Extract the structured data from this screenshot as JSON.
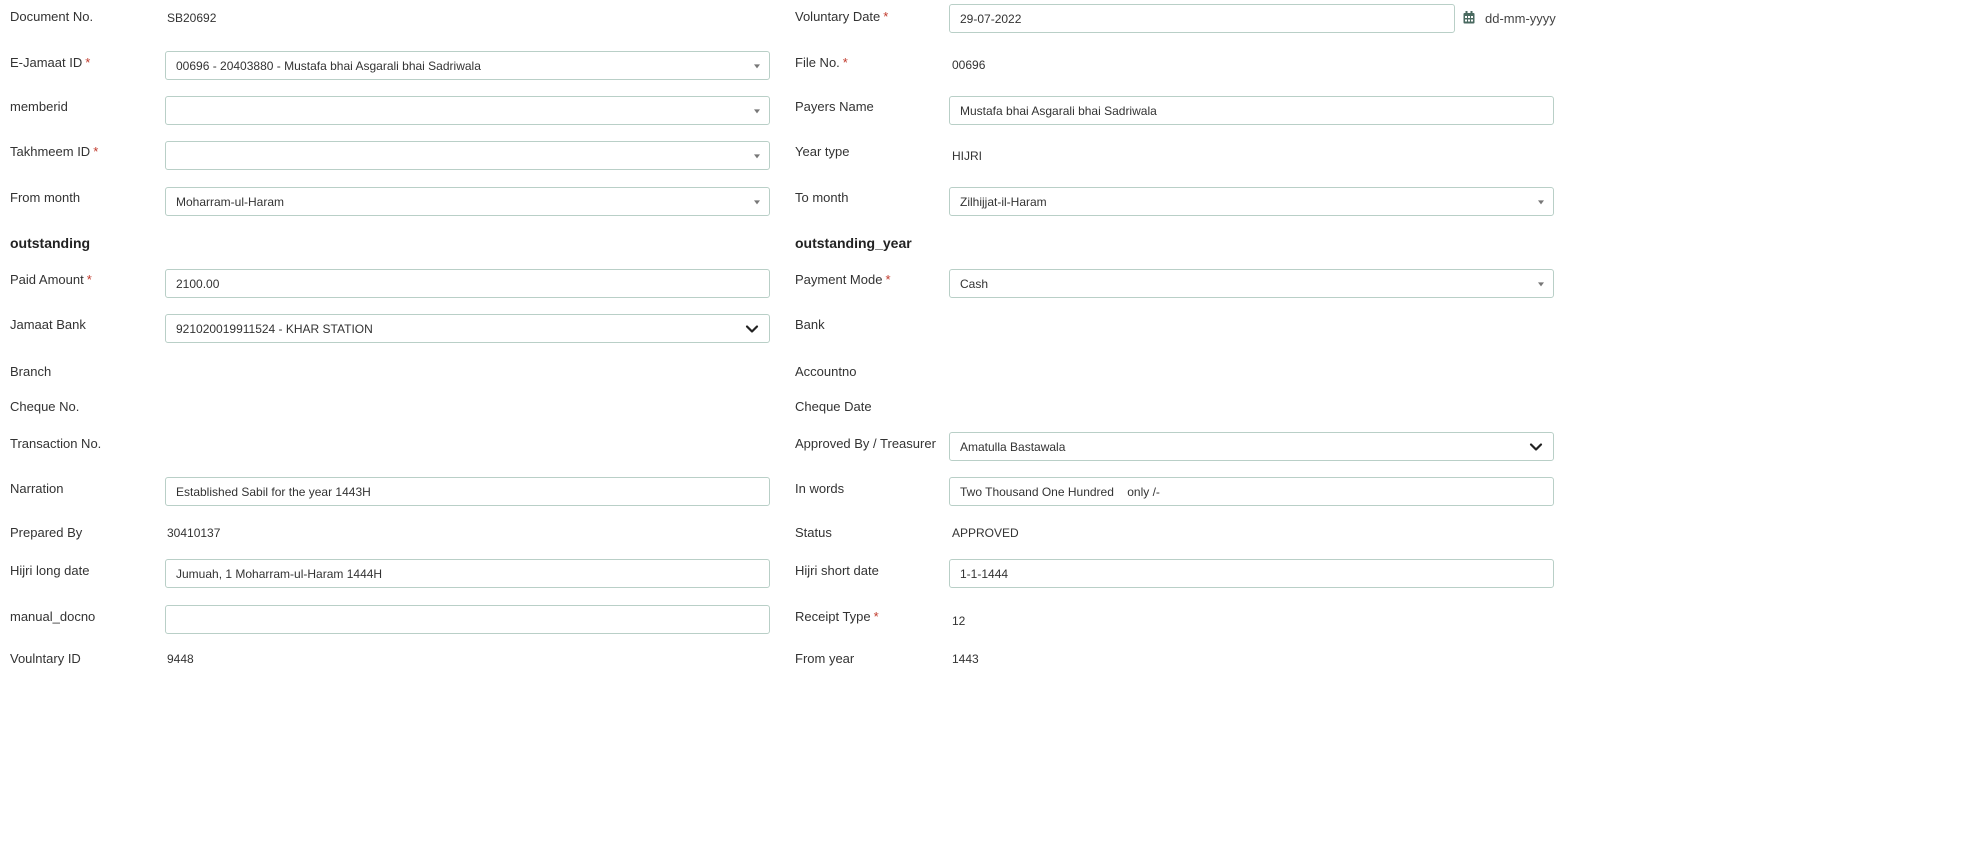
{
  "left": {
    "document_no": {
      "label": "Document No.",
      "value": "SB20692"
    },
    "ejamaat_id": {
      "label": "E-Jamaat ID",
      "required_mark": "*",
      "value": "00696 - 20403880 - Mustafa bhai Asgarali bhai Sadriwala"
    },
    "memberid": {
      "label": "memberid",
      "value": ""
    },
    "takhmeem_id": {
      "label": "Takhmeem ID",
      "required_mark": "*",
      "value": ""
    },
    "from_month": {
      "label": "From month",
      "value": "Moharram-ul-Haram"
    },
    "outstanding_heading": "outstanding",
    "paid_amount": {
      "label": "Paid Amount",
      "required_mark": "*",
      "value": "2100.00"
    },
    "jamaat_bank": {
      "label": "Jamaat Bank",
      "value": "921020019911524 - KHAR STATION"
    },
    "branch": {
      "label": "Branch"
    },
    "cheque_no": {
      "label": "Cheque No."
    },
    "transaction_no": {
      "label": "Transaction No."
    },
    "narration": {
      "label": "Narration",
      "value": "Established Sabil for the year 1443H"
    },
    "prepared_by": {
      "label": "Prepared By",
      "value": "30410137"
    },
    "hijri_long_date": {
      "label": "Hijri long date",
      "value": "Jumuah, 1 Moharram-ul-Haram 1444H"
    },
    "manual_docno": {
      "label": "manual_docno",
      "value": ""
    },
    "voluntary_id": {
      "label": "Voulntary ID",
      "value": "9448"
    }
  },
  "right": {
    "voluntary_date": {
      "label": "Voluntary Date",
      "required_mark": "*",
      "value": "29-07-2022",
      "format_hint": "dd-mm-yyyy"
    },
    "file_no": {
      "label": "File No.",
      "required_mark": "*",
      "value": "00696"
    },
    "payers_name": {
      "label": "Payers Name",
      "value": "Mustafa bhai  Asgarali bhai Sadriwala"
    },
    "year_type": {
      "label": "Year type",
      "value": "HIJRI"
    },
    "to_month": {
      "label": "To month",
      "value": "Zilhijjat-il-Haram"
    },
    "outstanding_year_heading": "outstanding_year",
    "payment_mode": {
      "label": "Payment Mode",
      "required_mark": "*",
      "value": "Cash"
    },
    "bank": {
      "label": "Bank"
    },
    "accountno": {
      "label": "Accountno"
    },
    "cheque_date": {
      "label": "Cheque Date"
    },
    "approved_by": {
      "label": "Approved By / Treasurer",
      "value": "Amatulla Bastawala"
    },
    "in_words": {
      "label": "In words",
      "value": "Two Thousand One Hundred    only /-"
    },
    "status": {
      "label": "Status",
      "value": "APPROVED"
    },
    "hijri_short_date": {
      "label": "Hijri short date",
      "value": "1-1-1444"
    },
    "receipt_type": {
      "label": "Receipt Type",
      "required_mark": "*",
      "value": "12"
    },
    "from_year": {
      "label": "From year",
      "value": "1443"
    }
  },
  "icons": {
    "calendar": "calendar-icon",
    "dropdown": "caret-down-icon",
    "chevron": "chevron-down-icon"
  },
  "colors": {
    "required": "#c0392b",
    "field_border": "#b9cfc7",
    "calendar_icon": "#4a6a60"
  }
}
